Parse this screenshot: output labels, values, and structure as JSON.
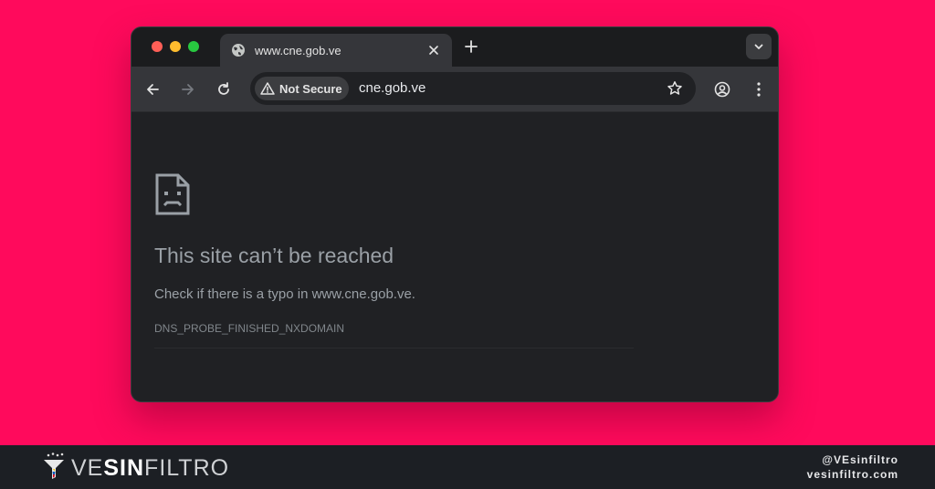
{
  "browser": {
    "tab": {
      "title": "www.cne.gob.ve",
      "icon": "globe-icon"
    },
    "omnibox": {
      "security_label": "Not Secure",
      "url": "cne.gob.ve"
    }
  },
  "error_page": {
    "title": "This site can’t be reached",
    "message": "Check if there is a typo in www.cne.gob.ve.",
    "code": "DNS_PROBE_FINISHED_NXDOMAIN"
  },
  "footer": {
    "brand_part1": "VE",
    "brand_part2": "SIN",
    "brand_part3": "FILTRO",
    "handle": "@VEsinfiltro",
    "website": "vesinfiltro.com"
  },
  "colors": {
    "background": "#ff0a5c",
    "window": "#202124",
    "toolbar": "#35363a",
    "footer": "#1c1f24"
  }
}
